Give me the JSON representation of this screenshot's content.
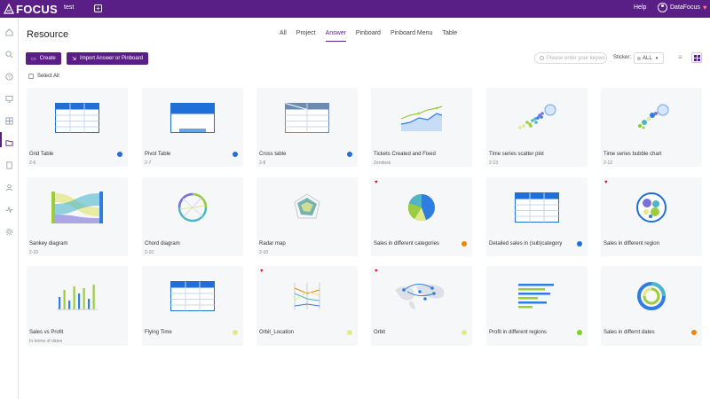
{
  "app": {
    "logo": "FOCUS",
    "tab_name": "test"
  },
  "topbar": {
    "help": "Help",
    "user_name": "DataFocus"
  },
  "sidebar": {
    "icons": [
      "home-icon",
      "search-icon",
      "help-icon",
      "monitor-icon",
      "grid-icon",
      "folder-icon",
      "bookmark-icon",
      "user-icon",
      "pulse-icon",
      "settings-icon"
    ],
    "active_index": 5
  },
  "page": {
    "title": "Resource"
  },
  "tabs": [
    "All",
    "Project",
    "Answer",
    "Pinboard",
    "Pinboard Menu",
    "Table"
  ],
  "active_tab": "Answer",
  "toolbar": {
    "create_label": "Create",
    "import_label": "Import Answer or Pinboard",
    "search_placeholder": "Please enter your keywo",
    "sticker_label": "Sticker:",
    "sticker_value": "ALL"
  },
  "select_all_label": "Select All",
  "colors": {
    "accent": "#5a1f86",
    "blue_dot": "#1f6fd6",
    "orange_dot": "#e8890c",
    "yellow_dot": "#e3e889",
    "lime_dot": "#7ed321",
    "heart": "#c8102e"
  },
  "cards": [
    {
      "title": "Grid Table",
      "sub": "2-6",
      "dot": "#1f6fd6",
      "heart": false,
      "thumb": "table"
    },
    {
      "title": "Pivot Table",
      "sub": "2-7",
      "dot": "#1f6fd6",
      "heart": false,
      "thumb": "pivot"
    },
    {
      "title": "Cross table",
      "sub": "2-8",
      "dot": "#1f6fd6",
      "heart": false,
      "thumb": "cross"
    },
    {
      "title": "Tickets Created and Fixed",
      "sub": "Zendesk",
      "dot": "",
      "heart": false,
      "thumb": "line"
    },
    {
      "title": "Time series scatter plot",
      "sub": "2-13",
      "dot": "",
      "heart": false,
      "thumb": "scatter"
    },
    {
      "title": "Time series bubble chart",
      "sub": "2-12",
      "dot": "",
      "heart": false,
      "thumb": "bubble"
    },
    {
      "title": "Sankey diagram",
      "sub": "2-10",
      "dot": "",
      "heart": false,
      "thumb": "sankey"
    },
    {
      "title": "Chord diagram",
      "sub": "2-10",
      "dot": "",
      "heart": false,
      "thumb": "chord"
    },
    {
      "title": "Radar map",
      "sub": "2-10",
      "dot": "",
      "heart": false,
      "thumb": "radar"
    },
    {
      "title": "Sales in different categories",
      "sub": "",
      "dot": "#e8890c",
      "heart": true,
      "thumb": "pie"
    },
    {
      "title": "Detailed sales in (sub)category",
      "sub": "",
      "dot": "#1f6fd6",
      "heart": false,
      "thumb": "table"
    },
    {
      "title": "Sales in different region",
      "sub": "",
      "dot": "",
      "heart": true,
      "thumb": "circles"
    },
    {
      "title": "Sales vs Profit",
      "sub": "In terms of dates",
      "dot": "",
      "heart": false,
      "thumb": "bars"
    },
    {
      "title": "Flying Time",
      "sub": "",
      "dot": "#e3e889",
      "heart": false,
      "thumb": "table"
    },
    {
      "title": "Orbit_Location",
      "sub": "",
      "dot": "#e3e889",
      "heart": true,
      "thumb": "parallel"
    },
    {
      "title": "Orbit",
      "sub": "",
      "dot": "#e3e889",
      "heart": true,
      "thumb": "map"
    },
    {
      "title": "Profit in different regions",
      "sub": "",
      "dot": "#7ed321",
      "heart": false,
      "thumb": "hbars"
    },
    {
      "title": "Sales in differnt dates",
      "sub": "",
      "dot": "#e8890c",
      "heart": false,
      "thumb": "donut"
    }
  ]
}
